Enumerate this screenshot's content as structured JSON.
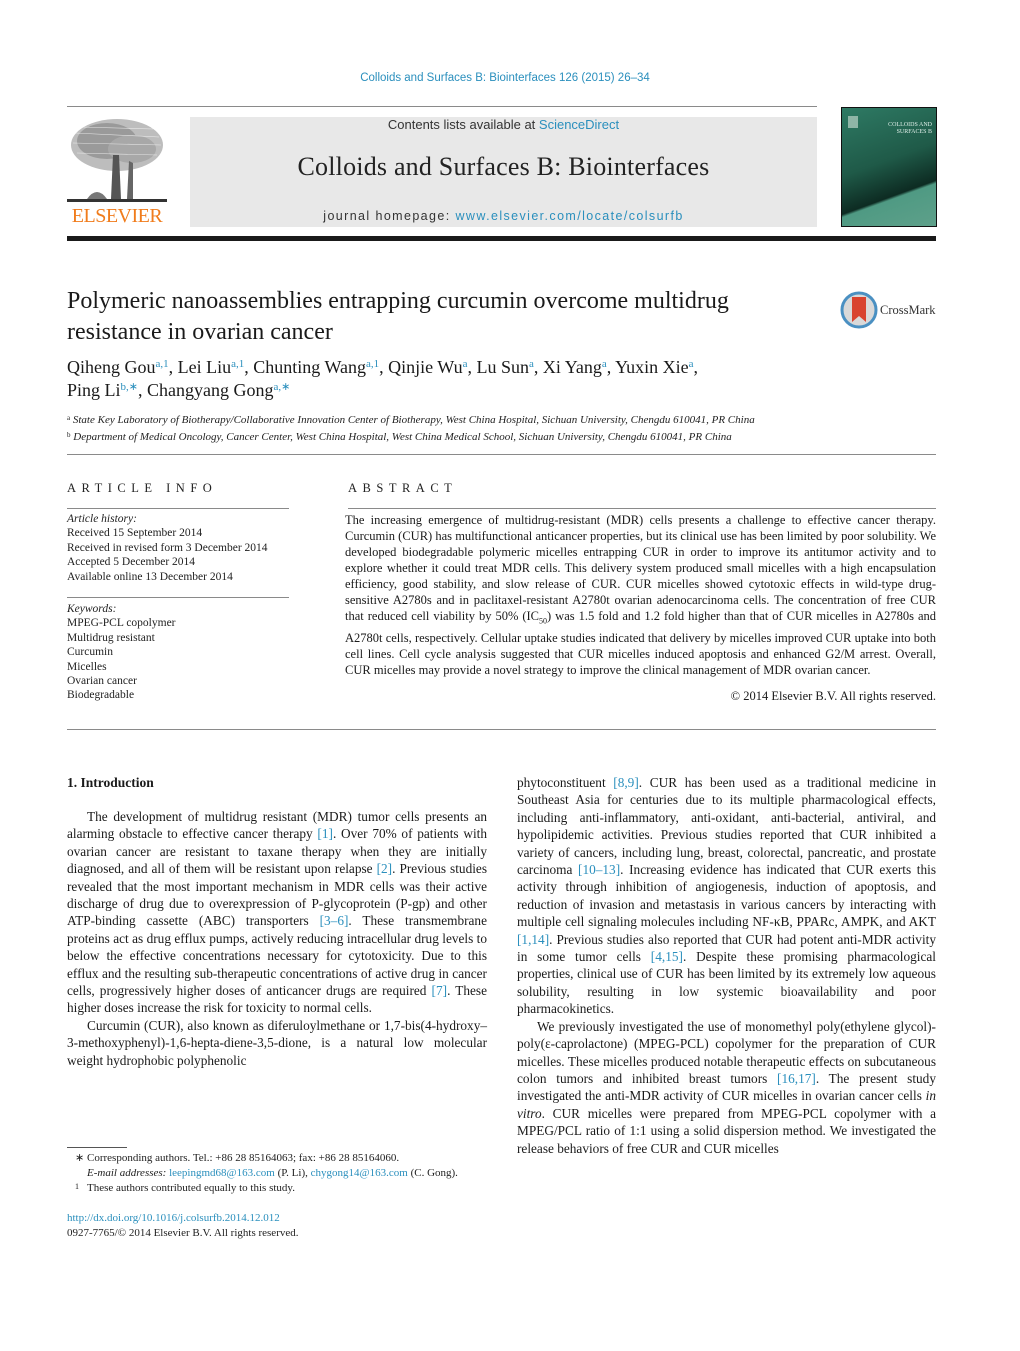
{
  "header": {
    "journal_ref": "Colloids and Surfaces B: Biointerfaces 126 (2015) 26–34",
    "contents_prefix": "Contents lists available at ",
    "contents_link": "ScienceDirect",
    "journal_name": "Colloids and Surfaces B: Biointerfaces",
    "homepage_prefix": "journal homepage: ",
    "homepage_link": "www.elsevier.com/locate/colsurfb",
    "publisher_logo_text": "ELSEVIER",
    "cover_title": "COLLOIDS AND SURFACES B",
    "brand_colors": {
      "link": "#2a8fbd",
      "elsevier_orange": "#f07c1c",
      "cover_green": "#2e7a64"
    }
  },
  "article": {
    "title": "Polymeric nanoassemblies entrapping curcumin overcome multidrug resistance in ovarian cancer",
    "crossmark_label": "CrossMark",
    "authors": [
      {
        "name": "Qiheng Gou",
        "sup": "a,1"
      },
      {
        "name": "Lei Liu",
        "sup": "a,1"
      },
      {
        "name": "Chunting Wang",
        "sup": "a,1"
      },
      {
        "name": "Qinjie Wu",
        "sup": "a"
      },
      {
        "name": "Lu Sun",
        "sup": "a"
      },
      {
        "name": "Xi Yang",
        "sup": "a"
      },
      {
        "name": "Yuxin Xie",
        "sup": "a"
      },
      {
        "name": "Ping Li",
        "sup": "b,∗"
      },
      {
        "name": "Changyang Gong",
        "sup": "a,∗"
      }
    ],
    "affiliations": [
      {
        "mark": "a",
        "text": "State Key Laboratory of Biotherapy/Collaborative Innovation Center of Biotherapy, West China Hospital, Sichuan University, Chengdu 610041, PR China"
      },
      {
        "mark": "b",
        "text": "Department of Medical Oncology, Cancer Center, West China Hospital, West China Medical School, Sichuan University, Chengdu 610041, PR China"
      }
    ]
  },
  "article_info": {
    "heading": "ARTICLE INFO",
    "history_label": "Article history:",
    "history": [
      "Received 15 September 2014",
      "Received in revised form 3 December 2014",
      "Accepted 5 December 2014",
      "Available online 13 December 2014"
    ],
    "keywords_label": "Keywords:",
    "keywords": [
      "MPEG-PCL copolymer",
      "Multidrug resistant",
      "Curcumin",
      "Micelles",
      "Ovarian cancer",
      "Biodegradable"
    ]
  },
  "abstract": {
    "heading": "ABSTRACT",
    "text_part1": "The increasing emergence of multidrug-resistant (MDR) cells presents a challenge to effective cancer therapy. Curcumin (CUR) has multifunctional anticancer properties, but its clinical use has been limited by poor solubility. We developed biodegradable polymeric micelles entrapping CUR in order to improve its antitumor activity and to explore whether it could treat MDR cells. This delivery system produced small micelles with a high encapsulation efficiency, good stability, and slow release of CUR. CUR micelles showed cytotoxic effects in wild-type drug-sensitive A2780s and in paclitaxel-resistant A2780t ovarian adenocarcinoma cells. The concentration of free CUR that reduced cell viability by 50% (IC",
    "text_sub": "50",
    "text_part2": ") was 1.5 fold and 1.2 fold higher than that of CUR micelles in A2780s and A2780t cells, respectively. Cellular uptake studies indicated that delivery by micelles improved CUR uptake into both cell lines. Cell cycle analysis suggested that CUR micelles induced apoptosis and enhanced G2/M arrest. Overall, CUR micelles may provide a novel strategy to improve the clinical management of MDR ovarian cancer.",
    "copyright": "© 2014 Elsevier B.V. All rights reserved."
  },
  "body": {
    "section_heading": "1.  Introduction",
    "left_paragraphs": [
      [
        {
          "t": "The development of multidrug resistant (MDR) tumor cells presents an alarming obstacle to effective cancer therapy "
        },
        {
          "ref": "[1]"
        },
        {
          "t": ". Over 70% of patients with ovarian cancer are resistant to taxane therapy when they are initially diagnosed, and all of them will be resistant upon relapse "
        },
        {
          "ref": "[2]"
        },
        {
          "t": ". Previous studies revealed that the most important mechanism in MDR cells was their active discharge of drug due to overexpression of P-glycoprotein (P-gp) and other ATP-binding cassette (ABC) transporters "
        },
        {
          "ref": "[3–6]"
        },
        {
          "t": ". These transmembrane proteins act as drug efflux pumps, actively reducing intracellular drug levels to below the effective concentrations necessary for cytotoxicity. Due to this efflux and the resulting sub-therapeutic concentrations of active drug in cancer cells, progressively higher doses of anticancer drugs are required "
        },
        {
          "ref": "[7]"
        },
        {
          "t": ". These higher doses increase the risk for toxicity to normal cells."
        }
      ],
      [
        {
          "t": "Curcumin (CUR), also known as diferuloylmethane or 1,7-bis(4-hydroxy–3-methoxyphenyl)-1,6-hepta-diene-3,5-dione, is a natural low molecular weight hydrophobic polyphenolic"
        }
      ]
    ],
    "right_paragraphs": [
      [
        {
          "t": "phytoconstituent "
        },
        {
          "ref": "[8,9]"
        },
        {
          "t": ". CUR has been used as a traditional medicine in Southeast Asia for centuries due to its multiple pharmacological effects, including anti-inflammatory, anti-oxidant, anti-bacterial, antiviral, and hypolipidemic activities. Previous studies reported that CUR inhibited a variety of cancers, including lung, breast, colorectal, pancreatic, and prostate carcinoma "
        },
        {
          "ref": "[10–13]"
        },
        {
          "t": ". Increasing evidence has indicated that CUR exerts this activity through inhibition of angiogenesis, induction of apoptosis, and reduction of invasion and metastasis in various cancers by interacting with multiple cell signaling molecules including NF-κB, PPARc, AMPK, and AKT "
        },
        {
          "ref": "[1,14]"
        },
        {
          "t": ". Previous studies also reported that CUR had potent anti-MDR activity in some tumor cells "
        },
        {
          "ref": "[4,15]"
        },
        {
          "t": ". Despite these promising pharmacological properties, clinical use of CUR has been limited by its extremely low aqueous solubility, resulting in low systemic bioavailability and poor pharmacokinetics."
        }
      ],
      [
        {
          "t": "We previously investigated the use of monomethyl poly(ethylene glycol)-poly(ε-caprolactone) (MPEG-PCL) copolymer for the preparation of CUR micelles. These micelles produced notable therapeutic effects on subcutaneous colon tumors and inhibited breast tumors "
        },
        {
          "ref": "[16,17]"
        },
        {
          "t": ". The present study investigated the anti-MDR activity of CUR micelles in ovarian cancer cells "
        },
        {
          "i": "in vitro"
        },
        {
          "t": ". CUR micelles were prepared from MPEG-PCL copolymer with a MPEG/PCL ratio of 1:1 using a solid dispersion method. We investigated the release behaviors of free CUR and CUR micelles"
        }
      ]
    ]
  },
  "footnotes": {
    "corresponding_mark": "∗",
    "corresponding_text": "Corresponding authors. Tel.: +86 28 85164063; fax: +86 28 85164060.",
    "email_label": "E-mail addresses:",
    "emails": [
      {
        "address": "leepingmd68@163.com",
        "who": "(P. Li),"
      },
      {
        "address": "chygong14@163.com",
        "who": "(C. Gong)."
      }
    ],
    "equal_mark": "1",
    "equal_text": "These authors contributed equally to this study.",
    "doi": "http://dx.doi.org/10.1016/j.colsurfb.2014.12.012",
    "issn": "0927-7765/© 2014 Elsevier B.V. All rights reserved."
  }
}
